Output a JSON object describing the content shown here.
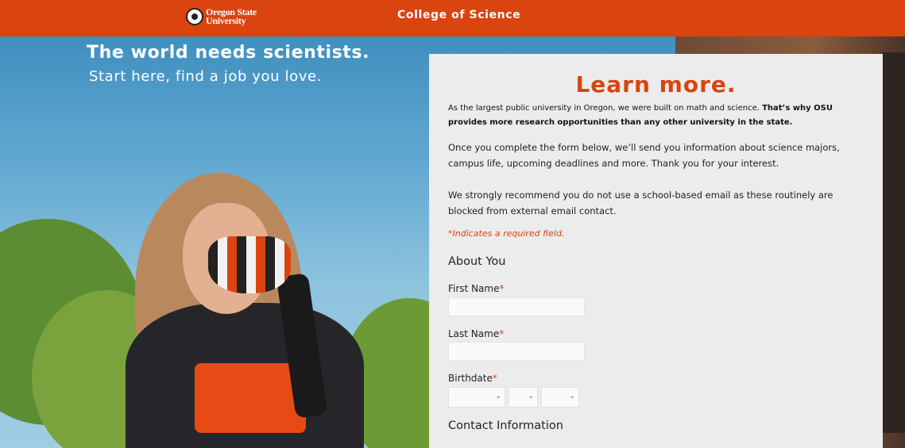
{
  "header": {
    "logo_line1": "Oregon State",
    "logo_line2": "University",
    "college": "College of Science"
  },
  "hero": {
    "title": "The world needs scientists.",
    "subtitle": "Start here, find a job you love."
  },
  "form": {
    "title": "Learn more.",
    "intro_plain": "As the largest public university in Oregon, we were built on math and science. ",
    "intro_bold": "That’s why OSU provides more research opportunities than any other university in the state.",
    "para1": "Once you complete the form below, we’ll send you information about science majors, campus life, upcoming deadlines and more. Thank you for your interest.",
    "para2": "We strongly recommend you do not use a school-based email as these routinely are blocked from external email contact.",
    "required_note": "*Indicates a required field.",
    "section_about": "About You",
    "first_name_label": "First Name",
    "last_name_label": "Last Name",
    "birthdate_label": "Birthdate",
    "required_star": "*",
    "section_contact": "Contact Information",
    "first_name_value": "",
    "last_name_value": "",
    "birth_month": "",
    "birth_day": "",
    "birth_year": ""
  },
  "colors": {
    "brand_orange": "#d9440f",
    "panel_bg": "#ececec"
  },
  "icons": {
    "select_chevron": "chevron-down-icon"
  }
}
